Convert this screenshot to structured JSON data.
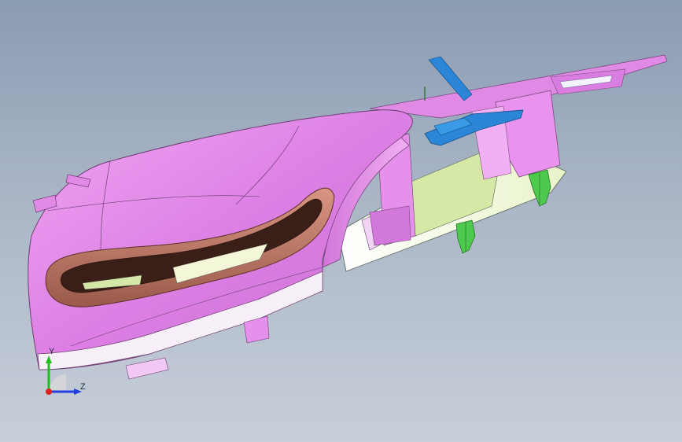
{
  "viewport": {
    "background_top": "#8a9bb2",
    "background_bottom": "#c7cfd9"
  },
  "model": {
    "part_color": "#e286e8",
    "slot_trim_color": "#b3705e",
    "inner_face_color": "#f7f9df",
    "clip_color": "#4dc94d",
    "bracket_color": "#2b86d8"
  },
  "triad": {
    "y_label": "Y",
    "z_label": "Z",
    "y_color": "#22bb22",
    "z_color": "#1f3fe0",
    "x_color": "#e02020"
  }
}
